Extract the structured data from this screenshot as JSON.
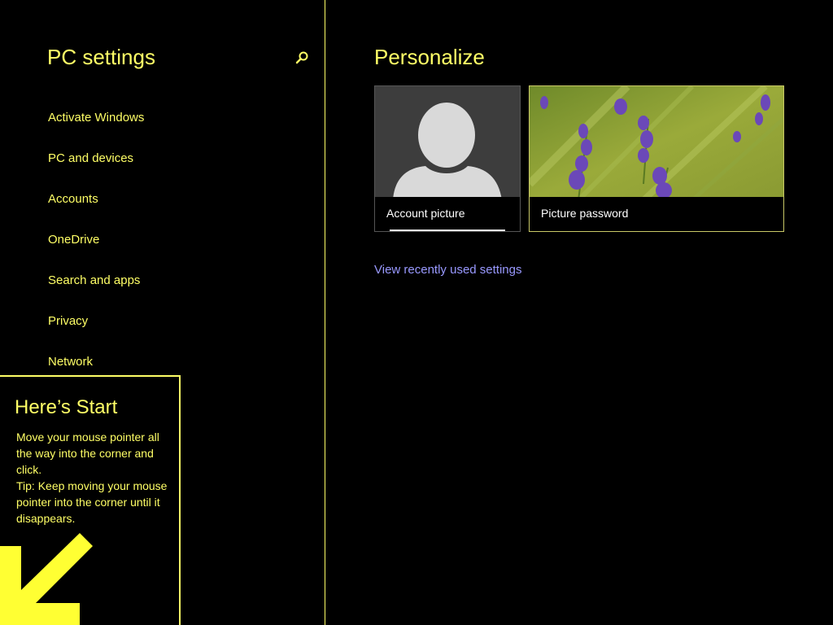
{
  "sidebar": {
    "title": "PC settings",
    "search_icon": "search-icon",
    "items": [
      {
        "label": "Activate Windows"
      },
      {
        "label": "PC and devices"
      },
      {
        "label": "Accounts"
      },
      {
        "label": "OneDrive"
      },
      {
        "label": "Search and apps"
      },
      {
        "label": "Privacy"
      },
      {
        "label": "Network"
      }
    ]
  },
  "main": {
    "title": "Personalize",
    "tiles": [
      {
        "label": "Account picture",
        "icon": "user-silhouette-icon"
      },
      {
        "label": "Picture password",
        "image": "lavender-flowers-image"
      }
    ],
    "recent_link": "View recently used settings"
  },
  "tip": {
    "title": "Here’s Start",
    "lines": [
      "Move your mouse pointer all the way into the corner and click.",
      "Tip: Keep moving your mouse pointer into the corner until it disappears."
    ],
    "arrow_icon": "arrow-down-left-icon"
  },
  "colors": {
    "background": "#000000",
    "accent_yellow": "#ffff66",
    "link_purple": "#9999ff",
    "tile_text": "#ffffff"
  }
}
